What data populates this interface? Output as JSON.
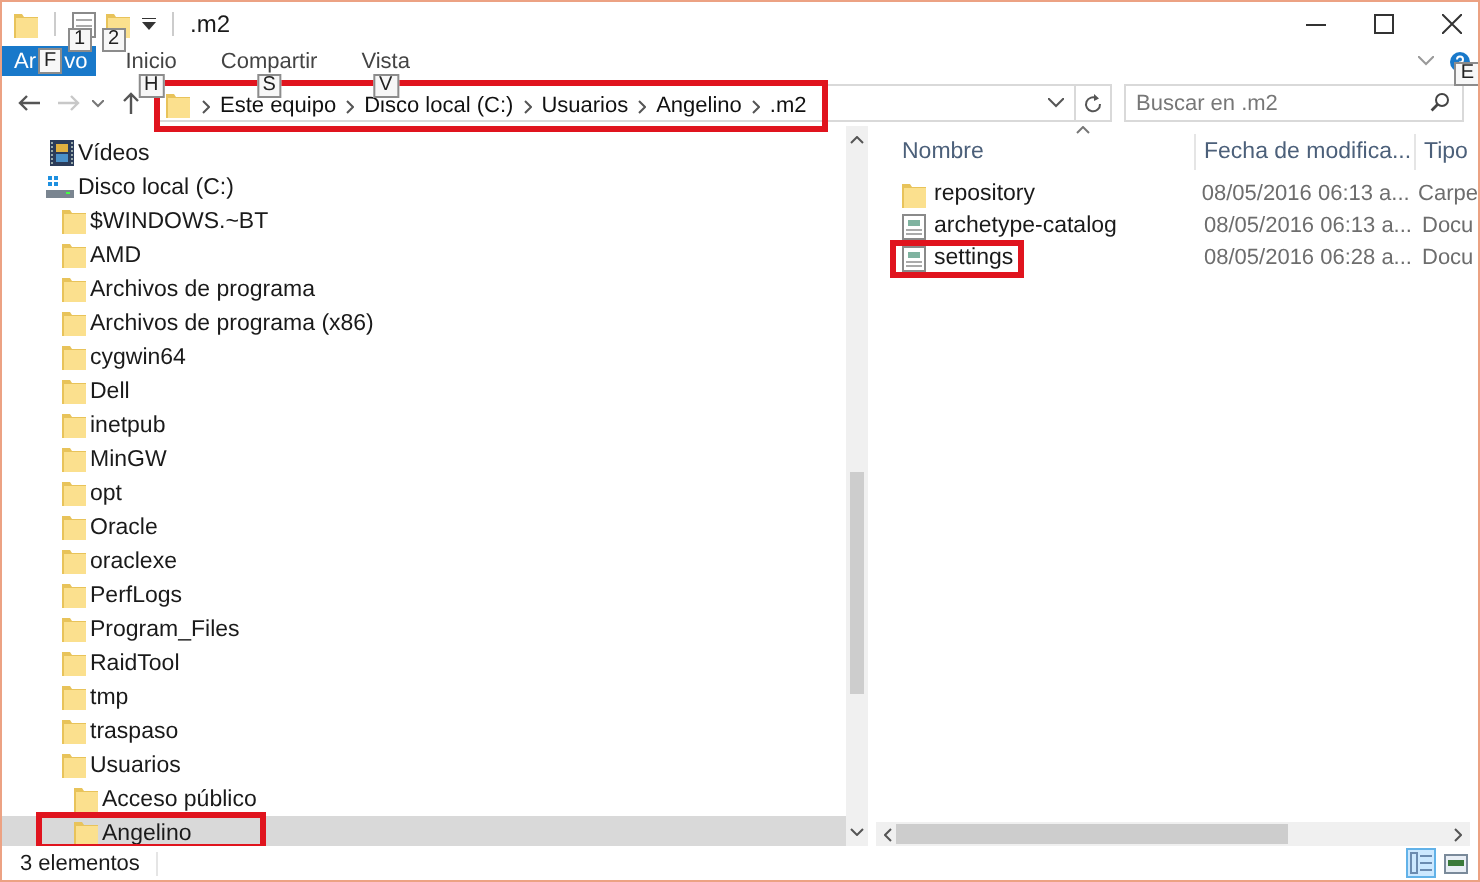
{
  "window": {
    "title": ".m2",
    "keytips": [
      "1",
      "2"
    ]
  },
  "ribbon": {
    "tabs": [
      {
        "kind": "file",
        "label_parts": [
          "Ar",
          "vo"
        ],
        "keytip": "F",
        "selected": false
      },
      {
        "kind": "tab",
        "label": "Inicio",
        "keytip": "H",
        "selected": false
      },
      {
        "kind": "tab",
        "label": "Compartir",
        "keytip": "S",
        "selected": false
      },
      {
        "kind": "tab",
        "label": "Vista",
        "keytip": "V",
        "selected": false
      }
    ],
    "help_keytip": "E"
  },
  "address_bar": {
    "crumbs": [
      "Este equipo",
      "Disco local (C:)",
      "Usuarios",
      "Angelino",
      ".m2"
    ],
    "annotated": true
  },
  "search": {
    "placeholder": "Buscar en .m2"
  },
  "tree": {
    "items": [
      {
        "label": "Vídeos",
        "kind": "videos",
        "selected": false,
        "annotated": false
      },
      {
        "label": "Disco local (C:)",
        "kind": "drive",
        "selected": false,
        "annotated": false,
        "children": [
          {
            "label": "$WINDOWS.~BT",
            "kind": "folder",
            "selected": false,
            "annotated": false
          },
          {
            "label": "AMD",
            "kind": "folder",
            "selected": false,
            "annotated": false
          },
          {
            "label": "Archivos de programa",
            "kind": "folder",
            "selected": false,
            "annotated": false
          },
          {
            "label": "Archivos de programa (x86)",
            "kind": "folder",
            "selected": false,
            "annotated": false
          },
          {
            "label": "cygwin64",
            "kind": "folder",
            "selected": false,
            "annotated": false
          },
          {
            "label": "Dell",
            "kind": "folder",
            "selected": false,
            "annotated": false
          },
          {
            "label": "inetpub",
            "kind": "folder",
            "selected": false,
            "annotated": false
          },
          {
            "label": "MinGW",
            "kind": "folder",
            "selected": false,
            "annotated": false
          },
          {
            "label": "opt",
            "kind": "folder",
            "selected": false,
            "annotated": false
          },
          {
            "label": "Oracle",
            "kind": "folder",
            "selected": false,
            "annotated": false
          },
          {
            "label": "oraclexe",
            "kind": "folder",
            "selected": false,
            "annotated": false
          },
          {
            "label": "PerfLogs",
            "kind": "folder",
            "selected": false,
            "annotated": false
          },
          {
            "label": "Program_Files",
            "kind": "folder",
            "selected": false,
            "annotated": false
          },
          {
            "label": "RaidTool",
            "kind": "folder",
            "selected": false,
            "annotated": false
          },
          {
            "label": "tmp",
            "kind": "folder",
            "selected": false,
            "annotated": false
          },
          {
            "label": "traspaso",
            "kind": "folder",
            "selected": false,
            "annotated": false
          },
          {
            "label": "Usuarios",
            "kind": "folder",
            "selected": false,
            "annotated": false,
            "children": [
              {
                "label": "Acceso público",
                "kind": "folder",
                "selected": false,
                "annotated": false
              },
              {
                "label": "Angelino",
                "kind": "folder",
                "selected": true,
                "annotated": true
              }
            ]
          }
        ]
      }
    ]
  },
  "files": {
    "columns": [
      {
        "label": "Nombre",
        "sorted": true
      },
      {
        "label": "Fecha de modifica...",
        "sorted": false
      },
      {
        "label": "Tipo",
        "sorted": false
      }
    ],
    "rows": [
      {
        "name": "repository",
        "kind": "folder",
        "date": "08/05/2016 06:13 a...",
        "type": "Carpe",
        "annotated": false
      },
      {
        "name": "archetype-catalog",
        "kind": "document",
        "date": "08/05/2016 06:13 a...",
        "type": "Docu",
        "annotated": false
      },
      {
        "name": "settings",
        "kind": "document",
        "date": "08/05/2016 06:28 a...",
        "type": "Docu",
        "annotated": true
      }
    ]
  },
  "status_bar": {
    "item_count": "3 elementos",
    "views": [
      {
        "kind": "details",
        "selected": true
      },
      {
        "kind": "tiles",
        "selected": false
      }
    ]
  }
}
